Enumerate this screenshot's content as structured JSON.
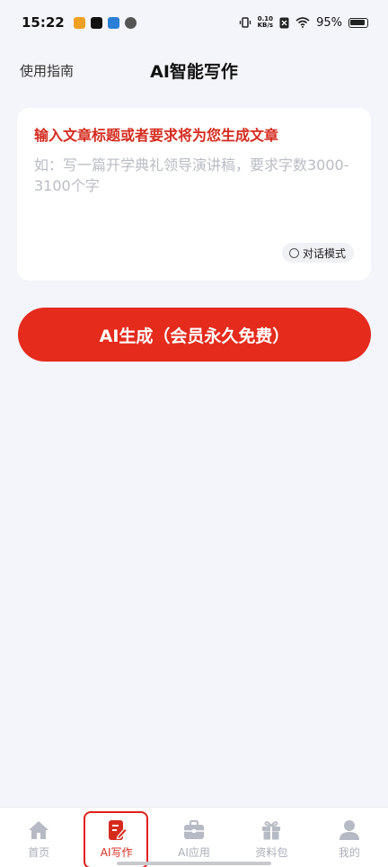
{
  "status_bar": {
    "time": "15:22",
    "net_speed_top": "0.10",
    "net_speed_bottom": "KB/s",
    "battery_percent": "95%"
  },
  "header": {
    "guide_link": "使用指南",
    "title": "AI智能写作"
  },
  "input_card": {
    "prompt_title": "输入文章标题或者要求将为您生成文章",
    "placeholder": "如：写一篇开学典礼领导演讲稿，要求字数3000-3100个字",
    "chat_mode_label": "对话模式"
  },
  "generate_button": {
    "label": "AI生成（会员永久免费）"
  },
  "bottom_nav": {
    "items": [
      {
        "label": "首页",
        "icon": "home-icon"
      },
      {
        "label": "AI写作",
        "icon": "write-icon"
      },
      {
        "label": "AI应用",
        "icon": "toolbox-icon"
      },
      {
        "label": "资料包",
        "icon": "gift-icon"
      },
      {
        "label": "我的",
        "icon": "profile-icon"
      }
    ],
    "active_index": 1
  },
  "colors": {
    "accent": "#e42b1c",
    "prompt_title": "#d52b1e",
    "background": "#f4f5fa",
    "inactive_nav": "#a9adb8"
  }
}
